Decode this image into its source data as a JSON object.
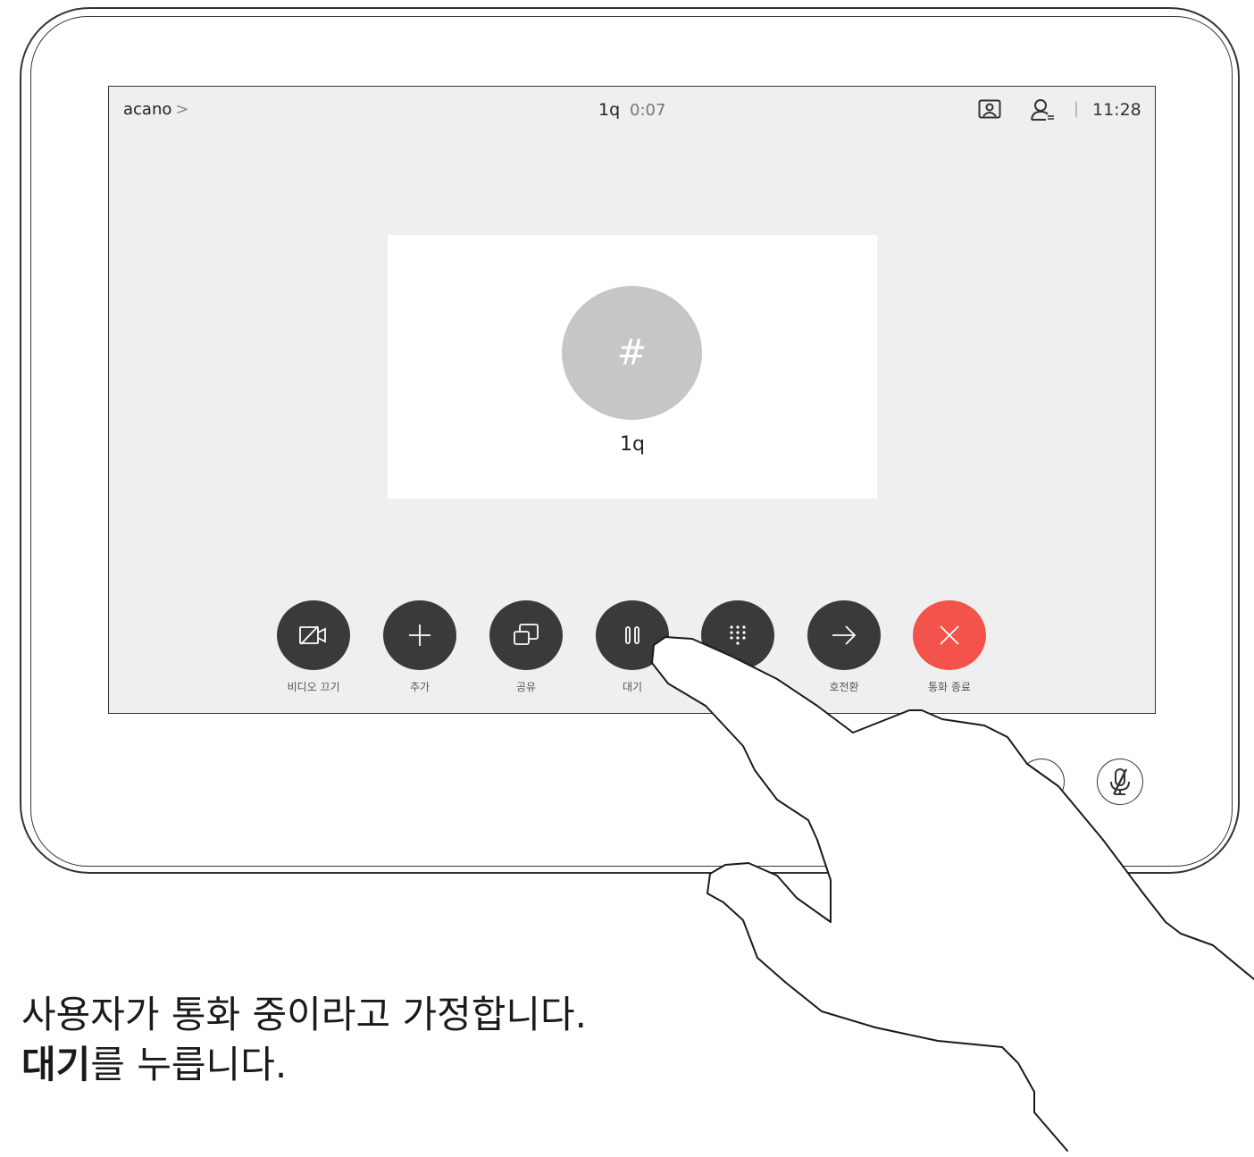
{
  "topbar": {
    "crumb": "acano",
    "crumb_chevron": ">",
    "call_name": "1q",
    "call_time": "0:07",
    "separator": "|",
    "clock": "11:28"
  },
  "card": {
    "avatar_glyph": "#",
    "name": "1q"
  },
  "controls": [
    {
      "label": "비디오 끄기",
      "icon": "video-off-icon"
    },
    {
      "label": "추가",
      "icon": "plus-icon"
    },
    {
      "label": "공유",
      "icon": "share-icon"
    },
    {
      "label": "대기",
      "icon": "hold-icon"
    },
    {
      "label": "",
      "icon": "keypad-icon"
    },
    {
      "label": "호전환",
      "icon": "transfer-arrow-icon"
    },
    {
      "label": "통화 종료",
      "icon": "close-icon"
    }
  ],
  "colors": {
    "end_call": "#f3534b",
    "control_button": "#3a3a3a",
    "screen_bg": "#efefef"
  },
  "instructions": {
    "line1": "사용자가 통화 중이라고 가정합니다.",
    "line2_bold": "대기",
    "line2_rest": "를 누릅니다."
  }
}
